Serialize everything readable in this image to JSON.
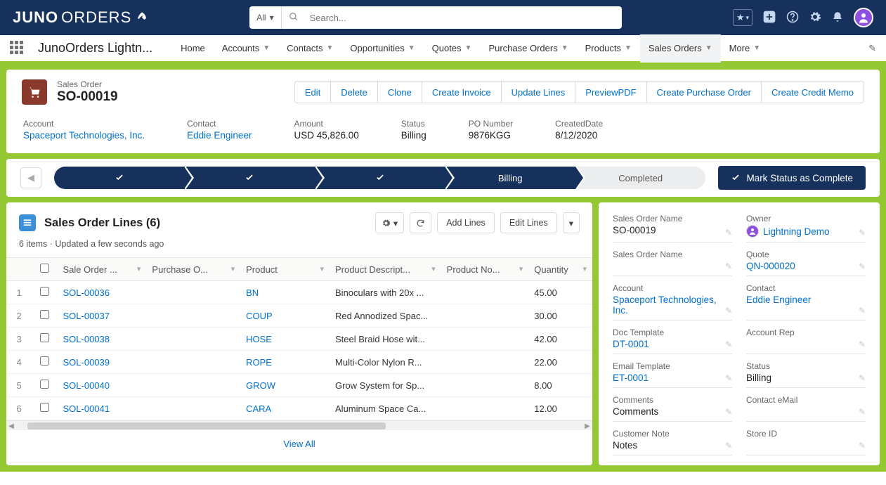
{
  "brand": {
    "logo_prefix": "JUNO",
    "logo_suffix": "ORDERS"
  },
  "search": {
    "scope": "All",
    "placeholder": "Search..."
  },
  "nav": {
    "app_name": "JunoOrders Lightn...",
    "tabs": [
      {
        "label": "Home",
        "chev": false
      },
      {
        "label": "Accounts",
        "chev": true
      },
      {
        "label": "Contacts",
        "chev": true
      },
      {
        "label": "Opportunities",
        "chev": true
      },
      {
        "label": "Quotes",
        "chev": true
      },
      {
        "label": "Purchase Orders",
        "chev": true
      },
      {
        "label": "Products",
        "chev": true
      },
      {
        "label": "Sales Orders",
        "chev": true,
        "active": true
      },
      {
        "label": "More",
        "chev": true
      }
    ]
  },
  "record": {
    "object_label": "Sales Order",
    "name": "SO-00019",
    "actions": [
      "Edit",
      "Delete",
      "Clone",
      "Create Invoice",
      "Update Lines",
      "PreviewPDF",
      "Create Purchase Order",
      "Create Credit Memo"
    ],
    "meta": [
      {
        "label": "Account",
        "value": "Spaceport Technologies, Inc.",
        "link": true
      },
      {
        "label": "Contact",
        "value": "Eddie Engineer",
        "link": true
      },
      {
        "label": "Amount",
        "value": "USD 45,826.00"
      },
      {
        "label": "Status",
        "value": "Billing"
      },
      {
        "label": "PO Number",
        "value": "9876KGG"
      },
      {
        "label": "CreatedDate",
        "value": "8/12/2020"
      }
    ]
  },
  "path": {
    "steps": [
      {
        "label": "",
        "done": true
      },
      {
        "label": "",
        "done": true
      },
      {
        "label": "",
        "done": true
      },
      {
        "label": "Billing",
        "done": true,
        "current": true
      },
      {
        "label": "Completed",
        "done": false
      }
    ],
    "complete_label": "Mark Status as Complete"
  },
  "lines": {
    "title": "Sales Order Lines (6)",
    "subtitle": "6 items · Updated a few seconds ago",
    "add_label": "Add Lines",
    "edit_label": "Edit Lines",
    "columns": [
      "Sale Order ...",
      "Purchase O...",
      "Product",
      "Product Descript...",
      "Product No...",
      "Quantity"
    ],
    "rows": [
      {
        "n": "1",
        "id": "SOL-00036",
        "po": "",
        "product": "BN",
        "desc": "Binoculars with 20x ...",
        "pn": "",
        "qty": "45.00"
      },
      {
        "n": "2",
        "id": "SOL-00037",
        "po": "",
        "product": "COUP",
        "desc": "Red Annodized Spac...",
        "pn": "",
        "qty": "30.00"
      },
      {
        "n": "3",
        "id": "SOL-00038",
        "po": "",
        "product": "HOSE",
        "desc": "Steel Braid Hose wit...",
        "pn": "",
        "qty": "42.00"
      },
      {
        "n": "4",
        "id": "SOL-00039",
        "po": "",
        "product": "ROPE",
        "desc": "Multi-Color Nylon R...",
        "pn": "",
        "qty": "22.00"
      },
      {
        "n": "5",
        "id": "SOL-00040",
        "po": "",
        "product": "GROW",
        "desc": "Grow System for Sp...",
        "pn": "",
        "qty": "8.00"
      },
      {
        "n": "6",
        "id": "SOL-00041",
        "po": "",
        "product": "CARA",
        "desc": "Aluminum Space Ca...",
        "pn": "",
        "qty": "12.00"
      }
    ],
    "view_all": "View All"
  },
  "detail": {
    "left": [
      {
        "label": "Sales Order Name",
        "value": "SO-00019"
      },
      {
        "label": "Sales Order Name",
        "value": ""
      },
      {
        "label": "Account",
        "value": "Spaceport Technologies, Inc.",
        "link": true
      },
      {
        "label": "Doc Template",
        "value": "DT-0001",
        "link": true
      },
      {
        "label": "Email Template",
        "value": "ET-0001",
        "link": true
      },
      {
        "label": "Comments",
        "value": "Comments"
      },
      {
        "label": "Customer Note",
        "value": "Notes"
      }
    ],
    "right": [
      {
        "label": "Owner",
        "value": "Lightning Demo",
        "owner": true
      },
      {
        "label": "Quote",
        "value": "QN-000020",
        "link": true
      },
      {
        "label": "Contact",
        "value": "Eddie Engineer",
        "link": true
      },
      {
        "label": "Account Rep",
        "value": ""
      },
      {
        "label": "Status",
        "value": "Billing"
      },
      {
        "label": "Contact eMail",
        "value": ""
      },
      {
        "label": "Store ID",
        "value": ""
      }
    ]
  }
}
